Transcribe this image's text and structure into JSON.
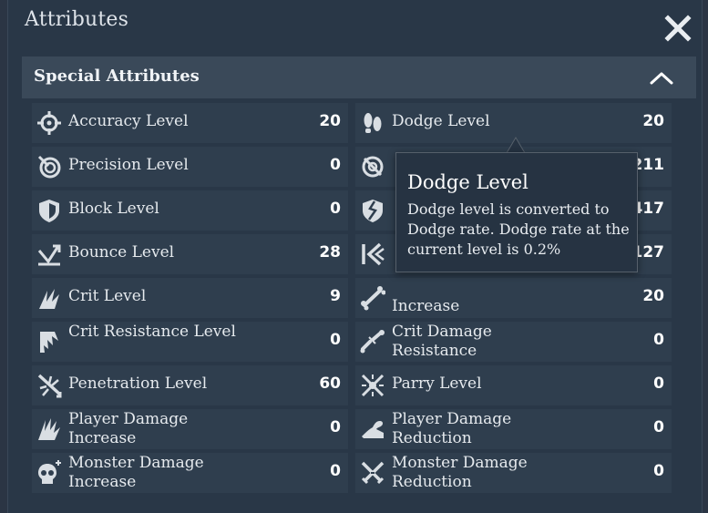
{
  "window": {
    "title": "Attributes",
    "close_icon": "close-icon"
  },
  "section": {
    "title": "Special Attributes",
    "collapse_icon": "chevron-up-icon"
  },
  "attributes_left": [
    {
      "label": "Accuracy Level",
      "value": "20",
      "icon": "crosshair-icon"
    },
    {
      "label": "Precision Level",
      "value": "0",
      "icon": "target-spiral-icon"
    },
    {
      "label": "Block Level",
      "value": "0",
      "icon": "shield-icon"
    },
    {
      "label": "Bounce Level",
      "value": "28",
      "icon": "bounce-arrow-icon"
    },
    {
      "label": "Crit Level",
      "value": "9",
      "icon": "crit-burst-icon"
    },
    {
      "label": "Crit Resistance Level",
      "value": "0",
      "icon": "crit-resist-icon"
    },
    {
      "label": "Penetration Level",
      "value": "60",
      "icon": "penetration-icon"
    },
    {
      "label": "Player Damage Increase",
      "value": "0",
      "icon": "claw-icon"
    },
    {
      "label": "Monster Damage Increase",
      "value": "0",
      "icon": "skull-icon"
    }
  ],
  "attributes_right": [
    {
      "label": "Dodge Level",
      "value": "20",
      "icon": "footprints-icon"
    },
    {
      "label": "",
      "value": "211",
      "icon": "no-target-icon"
    },
    {
      "label": "",
      "value": "417",
      "icon": "cracked-shield-icon"
    },
    {
      "label": "",
      "value": "127",
      "icon": "rebound-icon"
    },
    {
      "label": "Increase",
      "value": "20",
      "icon": "bone-icon"
    },
    {
      "label": "Crit Damage Resistance",
      "value": "0",
      "icon": "broken-bone-icon"
    },
    {
      "label": "Parry Level",
      "value": "0",
      "icon": "parry-icon"
    },
    {
      "label": "Player Damage Reduction",
      "value": "0",
      "icon": "arm-icon"
    },
    {
      "label": "Monster Damage Reduction",
      "value": "0",
      "icon": "crossed-swords-icon"
    }
  ],
  "tooltip": {
    "title": "Dodge Level",
    "body": "Dodge level is converted to Dodge rate. Dodge rate at the current level is 0.2%"
  }
}
